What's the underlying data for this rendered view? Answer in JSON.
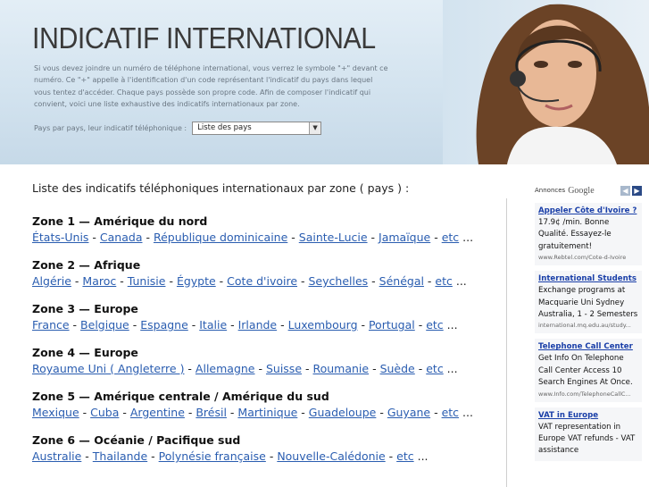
{
  "header": {
    "title": "INDICATIF INTERNATIONAL",
    "intro": "Si vous devez joindre un numéro de téléphone international, vous verrez le symbole \"+\" devant ce numéro. Ce \"+\" appelle à l'identification d'un code représentant l'indicatif du pays dans lequel vous tentez d'accéder. Chaque pays possède son propre code. Afin de composer l'indicatif qui convient, voici une liste exhaustive des indicatifs internationaux par zone.",
    "selector_label": "Pays par pays, leur indicatif téléphonique :",
    "selector_value": "Liste des pays"
  },
  "main": {
    "heading": "Liste des indicatifs téléphoniques internationaux par zone ( pays ) :",
    "zones": [
      {
        "title": "Zone 1 — Amérique du nord",
        "links": [
          "États-Unis",
          "Canada",
          "République dominicaine",
          "Sainte-Lucie",
          "Jamaïque",
          "etc"
        ]
      },
      {
        "title": "Zone 2 — Afrique",
        "links": [
          "Algérie",
          "Maroc",
          "Tunisie",
          "Égypte",
          "Cote d'ivoire",
          "Seychelles",
          "Sénégal",
          "etc"
        ]
      },
      {
        "title": "Zone 3 — Europe",
        "links": [
          "France",
          "Belgique",
          "Espagne",
          "Italie",
          "Irlande",
          "Luxembourg",
          "Portugal",
          "etc"
        ]
      },
      {
        "title": "Zone 4 — Europe",
        "links": [
          "Royaume Uni ( Angleterre )",
          "Allemagne",
          "Suisse",
          "Roumanie",
          "Suède",
          "etc"
        ]
      },
      {
        "title": "Zone 5 — Amérique centrale / Amérique du sud",
        "links": [
          "Mexique",
          "Cuba",
          "Argentine",
          "Brésil",
          "Martinique",
          "Guadeloupe",
          "Guyane",
          "etc"
        ]
      },
      {
        "title": "Zone 6 — Océanie / Pacifique sud",
        "links": [
          "Australie",
          "Thailande",
          "Polynésie française",
          "Nouvelle-Calédonie",
          "etc"
        ]
      }
    ],
    "separator": " - ",
    "ellipsis": " ..."
  },
  "ads": {
    "label": "Annonces",
    "brand": "Google",
    "items": [
      {
        "title": "Appeler Côte d'Ivoire ?",
        "text": "17.9¢ /min. Bonne Qualité. Essayez-le gratuitement!",
        "url": "www.Rebtel.com/Cote-d-Ivoire"
      },
      {
        "title": "International Students",
        "text": "Exchange programs at Macquarie Uni Sydney Australia, 1 - 2 Semesters",
        "url": "international.mq.edu.au/study..."
      },
      {
        "title": "Telephone Call Center",
        "text": "Get Info On Telephone Call Center Access 10 Search Engines At Once.",
        "url": "www.Info.com/TelephoneCallC..."
      },
      {
        "title": "VAT in Europe",
        "text": "VAT representation in Europe VAT refunds - VAT assistance",
        "url": ""
      }
    ]
  },
  "colors": {
    "link": "#2a5db0",
    "ad_title": "#1a3fa8",
    "header_bg": "#d3e3ef"
  }
}
